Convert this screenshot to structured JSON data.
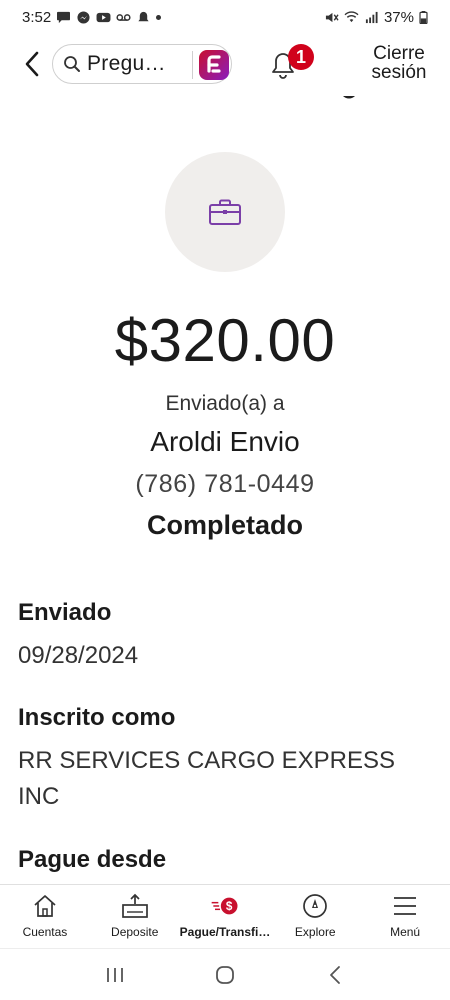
{
  "status_bar": {
    "time": "3:52",
    "battery": "37%",
    "icons_left": [
      "chat-icon",
      "messenger-icon",
      "youtube-icon",
      "voicemail-icon",
      "alarm-icon"
    ],
    "icons_right": [
      "mute-icon",
      "wifi-icon",
      "signal-icon",
      "battery-icon"
    ]
  },
  "header": {
    "search_text": "Pregu…",
    "notification_count": "1",
    "signout_label_line1": "Cierre",
    "signout_label_line2": "sesión",
    "brand_color": "#c8102e"
  },
  "transaction": {
    "icon": "briefcase-icon",
    "amount": "$320.00",
    "sent_to_label": "Enviado(a) a",
    "recipient": "Aroldi Envio",
    "phone": "(786) 781-0449",
    "status": "Completado"
  },
  "details": {
    "sent_label": "Enviado",
    "sent_date": "09/28/2024",
    "enrolled_label": "Inscrito como",
    "enrolled_value": "RR SERVICES CARGO EXPRESS INC",
    "paid_from_label": "Pague desde"
  },
  "bottom_nav": {
    "items": [
      {
        "label": "Cuentas",
        "icon": "home-icon"
      },
      {
        "label": "Deposite",
        "icon": "deposit-icon"
      },
      {
        "label": "Pague/Transfi…",
        "icon": "pay-transfer-icon"
      },
      {
        "label": "Explore",
        "icon": "compass-icon"
      },
      {
        "label": "Menú",
        "icon": "menu-icon"
      }
    ],
    "active_index": 2
  }
}
